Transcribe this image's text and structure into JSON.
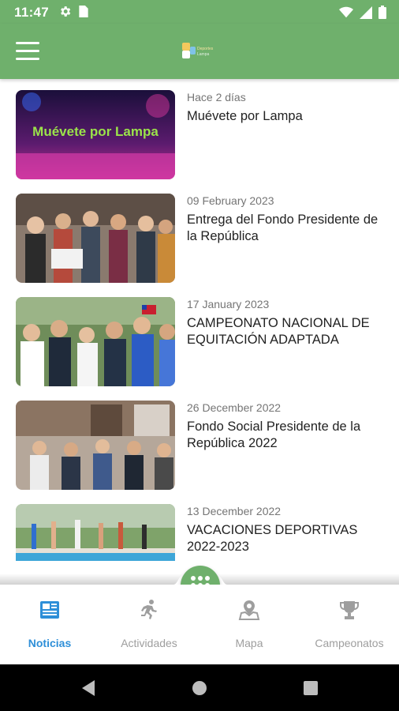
{
  "status": {
    "time": "11:47",
    "icons": [
      "gear-icon",
      "sim-card-icon",
      "wifi-icon",
      "signal-icon",
      "battery-icon"
    ]
  },
  "app": {
    "colors": {
      "primary": "#6fb06c",
      "active_tab": "#2e8fd8",
      "inactive_tab": "#9e9e9e"
    },
    "logo_text": "Deportes Lampa"
  },
  "news": [
    {
      "date": "Hace 2 días",
      "title": "Muévete por Lampa",
      "image_text": "Muévete por Lampa"
    },
    {
      "date": "09 February 2023",
      "title": "Entrega del Fondo Presidente de la República"
    },
    {
      "date": "17 January 2023",
      "title": "CAMPEONATO NACIONAL DE EQUITACIÓN ADAPTADA"
    },
    {
      "date": "26 December 2022",
      "title": "Fondo Social Presidente de la República 2022"
    },
    {
      "date": "13 December 2022",
      "title": "VACACIONES DEPORTIVAS 2022-2023"
    }
  ],
  "nav": {
    "tabs": [
      {
        "label": "Noticias",
        "icon": "newspaper-icon",
        "active": true
      },
      {
        "label": "Actividades",
        "icon": "runner-icon",
        "active": false
      },
      {
        "label": "Mapa",
        "icon": "map-pin-icon",
        "active": false
      },
      {
        "label": "Campeonatos",
        "icon": "trophy-icon",
        "active": false
      }
    ]
  }
}
